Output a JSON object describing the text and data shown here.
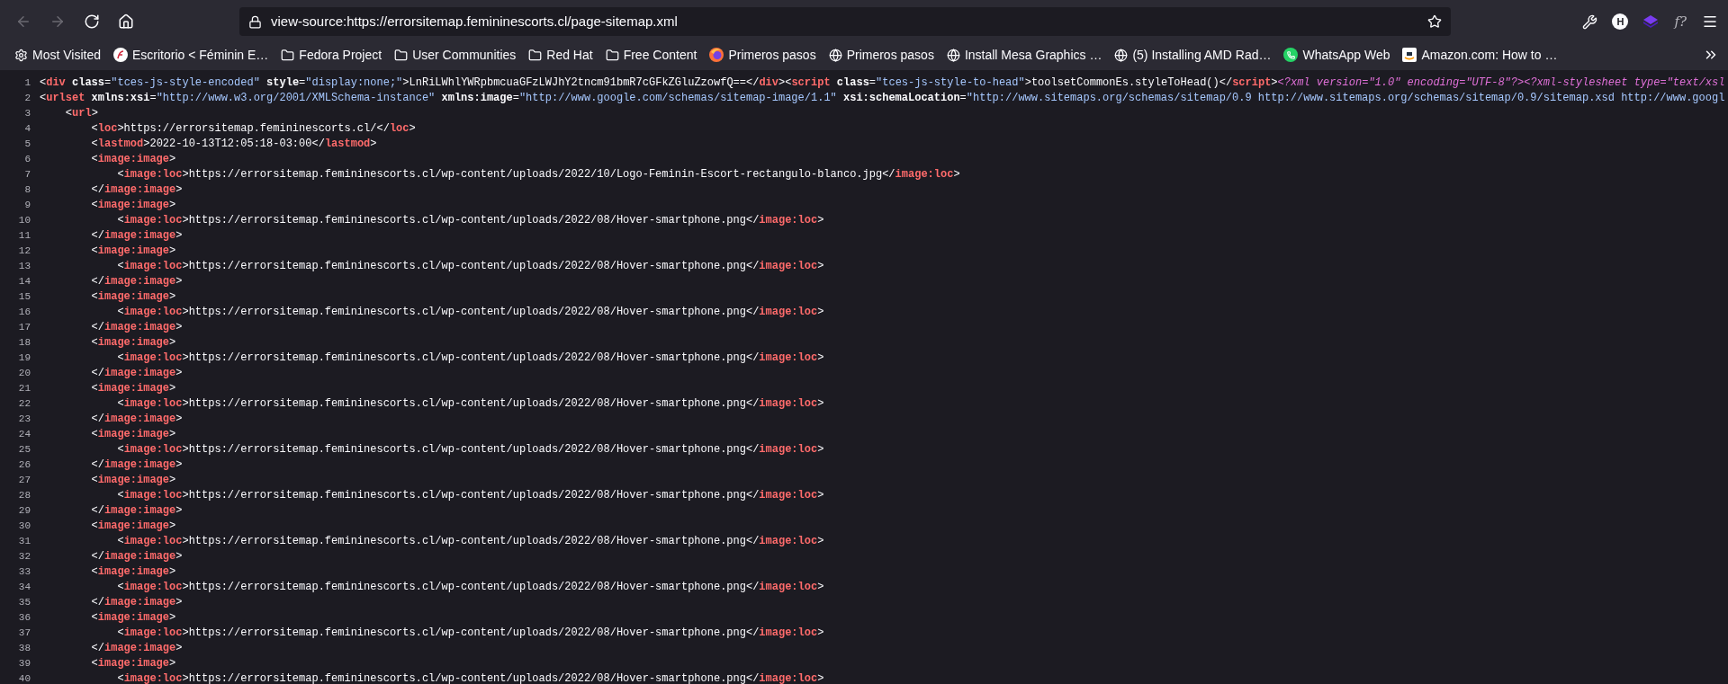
{
  "toolbar": {
    "nav_buttons": [
      {
        "kind": "back",
        "disabled": true
      },
      {
        "kind": "forward",
        "disabled": true
      },
      {
        "kind": "reload",
        "disabled": false
      },
      {
        "kind": "home",
        "disabled": false
      }
    ],
    "address": "view-source:https://errorsitemap.femininescorts.cl/page-sitemap.xml",
    "extensions": [
      {
        "kind": "wrench"
      },
      {
        "kind": "letter",
        "text": "H"
      },
      {
        "kind": "cube"
      },
      {
        "kind": "text",
        "text": "f?"
      },
      {
        "kind": "menu"
      }
    ]
  },
  "bookmarks": [
    {
      "kind": "gear",
      "label": "Most Visited"
    },
    {
      "kind": "site",
      "label": "Escritorio < Féminin E…"
    },
    {
      "kind": "folder",
      "label": "Fedora Project"
    },
    {
      "kind": "folder",
      "label": "User Communities"
    },
    {
      "kind": "folder",
      "label": "Red Hat"
    },
    {
      "kind": "folder",
      "label": "Free Content"
    },
    {
      "kind": "browser",
      "label": "Primeros pasos"
    },
    {
      "kind": "globe",
      "label": "Primeros pasos"
    },
    {
      "kind": "globe",
      "label": "Install Mesa Graphics …"
    },
    {
      "kind": "globe",
      "label": "(5) Installing AMD Rad…"
    },
    {
      "kind": "chat",
      "label": "WhatsApp Web"
    },
    {
      "kind": "store",
      "label": "Amazon.com: How to …"
    }
  ],
  "source_lines": [
    {
      "number": "1",
      "tokens": [
        {
          "kind": "plain",
          "text": "<"
        },
        {
          "kind": "tag",
          "text": "div"
        },
        {
          "kind": "attr",
          "text": " class"
        },
        {
          "kind": "plain",
          "text": "="
        },
        {
          "kind": "value",
          "text": "\"tces-js-style-encoded\""
        },
        {
          "kind": "attr",
          "text": " style"
        },
        {
          "kind": "plain",
          "text": "="
        },
        {
          "kind": "value",
          "text": "\"display:none;\""
        },
        {
          "kind": "plain",
          "text": ">LnRiLWhlYWRpbmcuaGFzLWJhY2tncm91bmR7cGFkZGluZzowfQ==</"
        },
        {
          "kind": "tag",
          "text": "div"
        },
        {
          "kind": "plain",
          "text": "><"
        },
        {
          "kind": "tag",
          "text": "script"
        },
        {
          "kind": "attr",
          "text": " class"
        },
        {
          "kind": "plain",
          "text": "="
        },
        {
          "kind": "value",
          "text": "\"tces-js-style-to-head\""
        },
        {
          "kind": "plain",
          "text": ">toolsetCommonEs.styleToHead()</"
        },
        {
          "kind": "tag",
          "text": "script"
        },
        {
          "kind": "plain",
          "text": ">"
        },
        {
          "kind": "pi",
          "text": "<?xml version=\"1.0\" encoding=\"UTF-8\"?><?xml-stylesheet type=\"text/xsl"
        }
      ]
    },
    {
      "number": "2",
      "tokens": [
        {
          "kind": "plain",
          "text": "<"
        },
        {
          "kind": "tag",
          "text": "urlset"
        },
        {
          "kind": "attr",
          "text": " xmlns:xsi"
        },
        {
          "kind": "plain",
          "text": "="
        },
        {
          "kind": "value",
          "text": "\"http://www.w3.org/2001/XMLSchema-instance\""
        },
        {
          "kind": "attr",
          "text": " xmlns:image"
        },
        {
          "kind": "plain",
          "text": "="
        },
        {
          "kind": "value",
          "text": "\"http://www.google.com/schemas/sitemap-image/1.1\""
        },
        {
          "kind": "attr",
          "text": " xsi:schemaLocation"
        },
        {
          "kind": "plain",
          "text": "="
        },
        {
          "kind": "value",
          "text": "\"http://www.sitemaps.org/schemas/sitemap/0.9 http://www.sitemaps.org/schemas/sitemap/0.9/sitemap.xsd http://www.googl"
        }
      ]
    },
    {
      "number": "3",
      "tokens": [
        {
          "kind": "plain",
          "text": "    <"
        },
        {
          "kind": "tag",
          "text": "url"
        },
        {
          "kind": "plain",
          "text": ">"
        }
      ]
    },
    {
      "number": "4",
      "tokens": [
        {
          "kind": "plain",
          "text": "        <"
        },
        {
          "kind": "tag",
          "text": "loc"
        },
        {
          "kind": "plain",
          "text": ">https://errorsitemap.femininescorts.cl/</"
        },
        {
          "kind": "tag",
          "text": "loc"
        },
        {
          "kind": "plain",
          "text": ">"
        }
      ]
    },
    {
      "number": "5",
      "tokens": [
        {
          "kind": "plain",
          "text": "        <"
        },
        {
          "kind": "tag",
          "text": "lastmod"
        },
        {
          "kind": "plain",
          "text": ">2022-10-13T12:05:18-03:00</"
        },
        {
          "kind": "tag",
          "text": "lastmod"
        },
        {
          "kind": "plain",
          "text": ">"
        }
      ]
    },
    {
      "number": "6",
      "tokens": [
        {
          "kind": "plain",
          "text": "        <"
        },
        {
          "kind": "tag",
          "text": "image:image"
        },
        {
          "kind": "plain",
          "text": ">"
        }
      ]
    },
    {
      "number": "7",
      "tokens": [
        {
          "kind": "plain",
          "text": "            <"
        },
        {
          "kind": "tag",
          "text": "image:loc"
        },
        {
          "kind": "plain",
          "text": ">https://errorsitemap.femininescorts.cl/wp-content/uploads/2022/10/Logo-Feminin-Escort-rectangulo-blanco.jpg</"
        },
        {
          "kind": "tag",
          "text": "image:loc"
        },
        {
          "kind": "plain",
          "text": ">"
        }
      ]
    },
    {
      "number": "8",
      "tokens": [
        {
          "kind": "plain",
          "text": "        </"
        },
        {
          "kind": "tag",
          "text": "image:image"
        },
        {
          "kind": "plain",
          "text": ">"
        }
      ]
    },
    {
      "number": "9",
      "tokens": [
        {
          "kind": "plain",
          "text": "        <"
        },
        {
          "kind": "tag",
          "text": "image:image"
        },
        {
          "kind": "plain",
          "text": ">"
        }
      ]
    },
    {
      "number": "10",
      "tokens": [
        {
          "kind": "plain",
          "text": "            <"
        },
        {
          "kind": "tag",
          "text": "image:loc"
        },
        {
          "kind": "plain",
          "text": ">https://errorsitemap.femininescorts.cl/wp-content/uploads/2022/08/Hover-smartphone.png</"
        },
        {
          "kind": "tag",
          "text": "image:loc"
        },
        {
          "kind": "plain",
          "text": ">"
        }
      ]
    },
    {
      "number": "11",
      "tokens": [
        {
          "kind": "plain",
          "text": "        </"
        },
        {
          "kind": "tag",
          "text": "image:image"
        },
        {
          "kind": "plain",
          "text": ">"
        }
      ]
    },
    {
      "number": "12",
      "tokens": [
        {
          "kind": "plain",
          "text": "        <"
        },
        {
          "kind": "tag",
          "text": "image:image"
        },
        {
          "kind": "plain",
          "text": ">"
        }
      ]
    },
    {
      "number": "13",
      "tokens": [
        {
          "kind": "plain",
          "text": "            <"
        },
        {
          "kind": "tag",
          "text": "image:loc"
        },
        {
          "kind": "plain",
          "text": ">https://errorsitemap.femininescorts.cl/wp-content/uploads/2022/08/Hover-smartphone.png</"
        },
        {
          "kind": "tag",
          "text": "image:loc"
        },
        {
          "kind": "plain",
          "text": ">"
        }
      ]
    },
    {
      "number": "14",
      "tokens": [
        {
          "kind": "plain",
          "text": "        </"
        },
        {
          "kind": "tag",
          "text": "image:image"
        },
        {
          "kind": "plain",
          "text": ">"
        }
      ]
    },
    {
      "number": "15",
      "tokens": [
        {
          "kind": "plain",
          "text": "        <"
        },
        {
          "kind": "tag",
          "text": "image:image"
        },
        {
          "kind": "plain",
          "text": ">"
        }
      ]
    },
    {
      "number": "16",
      "tokens": [
        {
          "kind": "plain",
          "text": "            <"
        },
        {
          "kind": "tag",
          "text": "image:loc"
        },
        {
          "kind": "plain",
          "text": ">https://errorsitemap.femininescorts.cl/wp-content/uploads/2022/08/Hover-smartphone.png</"
        },
        {
          "kind": "tag",
          "text": "image:loc"
        },
        {
          "kind": "plain",
          "text": ">"
        }
      ]
    },
    {
      "number": "17",
      "tokens": [
        {
          "kind": "plain",
          "text": "        </"
        },
        {
          "kind": "tag",
          "text": "image:image"
        },
        {
          "kind": "plain",
          "text": ">"
        }
      ]
    },
    {
      "number": "18",
      "tokens": [
        {
          "kind": "plain",
          "text": "        <"
        },
        {
          "kind": "tag",
          "text": "image:image"
        },
        {
          "kind": "plain",
          "text": ">"
        }
      ]
    },
    {
      "number": "19",
      "tokens": [
        {
          "kind": "plain",
          "text": "            <"
        },
        {
          "kind": "tag",
          "text": "image:loc"
        },
        {
          "kind": "plain",
          "text": ">https://errorsitemap.femininescorts.cl/wp-content/uploads/2022/08/Hover-smartphone.png</"
        },
        {
          "kind": "tag",
          "text": "image:loc"
        },
        {
          "kind": "plain",
          "text": ">"
        }
      ]
    },
    {
      "number": "20",
      "tokens": [
        {
          "kind": "plain",
          "text": "        </"
        },
        {
          "kind": "tag",
          "text": "image:image"
        },
        {
          "kind": "plain",
          "text": ">"
        }
      ]
    },
    {
      "number": "21",
      "tokens": [
        {
          "kind": "plain",
          "text": "        <"
        },
        {
          "kind": "tag",
          "text": "image:image"
        },
        {
          "kind": "plain",
          "text": ">"
        }
      ]
    },
    {
      "number": "22",
      "tokens": [
        {
          "kind": "plain",
          "text": "            <"
        },
        {
          "kind": "tag",
          "text": "image:loc"
        },
        {
          "kind": "plain",
          "text": ">https://errorsitemap.femininescorts.cl/wp-content/uploads/2022/08/Hover-smartphone.png</"
        },
        {
          "kind": "tag",
          "text": "image:loc"
        },
        {
          "kind": "plain",
          "text": ">"
        }
      ]
    },
    {
      "number": "23",
      "tokens": [
        {
          "kind": "plain",
          "text": "        </"
        },
        {
          "kind": "tag",
          "text": "image:image"
        },
        {
          "kind": "plain",
          "text": ">"
        }
      ]
    },
    {
      "number": "24",
      "tokens": [
        {
          "kind": "plain",
          "text": "        <"
        },
        {
          "kind": "tag",
          "text": "image:image"
        },
        {
          "kind": "plain",
          "text": ">"
        }
      ]
    },
    {
      "number": "25",
      "tokens": [
        {
          "kind": "plain",
          "text": "            <"
        },
        {
          "kind": "tag",
          "text": "image:loc"
        },
        {
          "kind": "plain",
          "text": ">https://errorsitemap.femininescorts.cl/wp-content/uploads/2022/08/Hover-smartphone.png</"
        },
        {
          "kind": "tag",
          "text": "image:loc"
        },
        {
          "kind": "plain",
          "text": ">"
        }
      ]
    },
    {
      "number": "26",
      "tokens": [
        {
          "kind": "plain",
          "text": "        </"
        },
        {
          "kind": "tag",
          "text": "image:image"
        },
        {
          "kind": "plain",
          "text": ">"
        }
      ]
    },
    {
      "number": "27",
      "tokens": [
        {
          "kind": "plain",
          "text": "        <"
        },
        {
          "kind": "tag",
          "text": "image:image"
        },
        {
          "kind": "plain",
          "text": ">"
        }
      ]
    },
    {
      "number": "28",
      "tokens": [
        {
          "kind": "plain",
          "text": "            <"
        },
        {
          "kind": "tag",
          "text": "image:loc"
        },
        {
          "kind": "plain",
          "text": ">https://errorsitemap.femininescorts.cl/wp-content/uploads/2022/08/Hover-smartphone.png</"
        },
        {
          "kind": "tag",
          "text": "image:loc"
        },
        {
          "kind": "plain",
          "text": ">"
        }
      ]
    },
    {
      "number": "29",
      "tokens": [
        {
          "kind": "plain",
          "text": "        </"
        },
        {
          "kind": "tag",
          "text": "image:image"
        },
        {
          "kind": "plain",
          "text": ">"
        }
      ]
    },
    {
      "number": "30",
      "tokens": [
        {
          "kind": "plain",
          "text": "        <"
        },
        {
          "kind": "tag",
          "text": "image:image"
        },
        {
          "kind": "plain",
          "text": ">"
        }
      ]
    },
    {
      "number": "31",
      "tokens": [
        {
          "kind": "plain",
          "text": "            <"
        },
        {
          "kind": "tag",
          "text": "image:loc"
        },
        {
          "kind": "plain",
          "text": ">https://errorsitemap.femininescorts.cl/wp-content/uploads/2022/08/Hover-smartphone.png</"
        },
        {
          "kind": "tag",
          "text": "image:loc"
        },
        {
          "kind": "plain",
          "text": ">"
        }
      ]
    },
    {
      "number": "32",
      "tokens": [
        {
          "kind": "plain",
          "text": "        </"
        },
        {
          "kind": "tag",
          "text": "image:image"
        },
        {
          "kind": "plain",
          "text": ">"
        }
      ]
    },
    {
      "number": "33",
      "tokens": [
        {
          "kind": "plain",
          "text": "        <"
        },
        {
          "kind": "tag",
          "text": "image:image"
        },
        {
          "kind": "plain",
          "text": ">"
        }
      ]
    },
    {
      "number": "34",
      "tokens": [
        {
          "kind": "plain",
          "text": "            <"
        },
        {
          "kind": "tag",
          "text": "image:loc"
        },
        {
          "kind": "plain",
          "text": ">https://errorsitemap.femininescorts.cl/wp-content/uploads/2022/08/Hover-smartphone.png</"
        },
        {
          "kind": "tag",
          "text": "image:loc"
        },
        {
          "kind": "plain",
          "text": ">"
        }
      ]
    },
    {
      "number": "35",
      "tokens": [
        {
          "kind": "plain",
          "text": "        </"
        },
        {
          "kind": "tag",
          "text": "image:image"
        },
        {
          "kind": "plain",
          "text": ">"
        }
      ]
    },
    {
      "number": "36",
      "tokens": [
        {
          "kind": "plain",
          "text": "        <"
        },
        {
          "kind": "tag",
          "text": "image:image"
        },
        {
          "kind": "plain",
          "text": ">"
        }
      ]
    },
    {
      "number": "37",
      "tokens": [
        {
          "kind": "plain",
          "text": "            <"
        },
        {
          "kind": "tag",
          "text": "image:loc"
        },
        {
          "kind": "plain",
          "text": ">https://errorsitemap.femininescorts.cl/wp-content/uploads/2022/08/Hover-smartphone.png</"
        },
        {
          "kind": "tag",
          "text": "image:loc"
        },
        {
          "kind": "plain",
          "text": ">"
        }
      ]
    },
    {
      "number": "38",
      "tokens": [
        {
          "kind": "plain",
          "text": "        </"
        },
        {
          "kind": "tag",
          "text": "image:image"
        },
        {
          "kind": "plain",
          "text": ">"
        }
      ]
    },
    {
      "number": "39",
      "tokens": [
        {
          "kind": "plain",
          "text": "        <"
        },
        {
          "kind": "tag",
          "text": "image:image"
        },
        {
          "kind": "plain",
          "text": ">"
        }
      ]
    },
    {
      "number": "40",
      "tokens": [
        {
          "kind": "plain",
          "text": "            <"
        },
        {
          "kind": "tag",
          "text": "image:loc"
        },
        {
          "kind": "plain",
          "text": ">https://errorsitemap.femininescorts.cl/wp-content/uploads/2022/08/Hover-smartphone.png</"
        },
        {
          "kind": "tag",
          "text": "image:loc"
        },
        {
          "kind": "plain",
          "text": ">"
        }
      ]
    }
  ]
}
